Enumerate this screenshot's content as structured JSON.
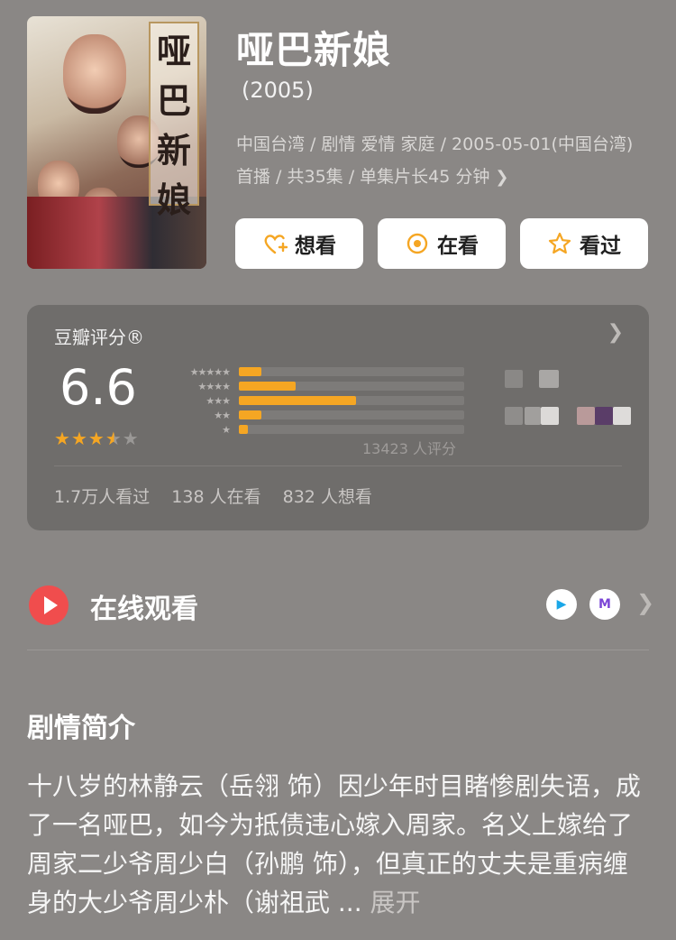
{
  "movie": {
    "title": "哑巴新娘",
    "year": "(2005)",
    "meta_line": "中国台湾 / 剧情 爱情 家庭 / 2005-05-01(中国台湾) 首播 / 共35集 / 单集片长45 分钟",
    "poster_title_chars": [
      "哑",
      "巴",
      "新",
      "娘"
    ]
  },
  "actions": {
    "want": "想看",
    "watching": "在看",
    "watched": "看过"
  },
  "rating": {
    "label": "豆瓣评分®",
    "score": "6.6",
    "stars": 3.5,
    "distribution": [
      {
        "stars": "★★★★★",
        "fraction": 0.1
      },
      {
        "stars": "★★★★",
        "fraction": 0.25
      },
      {
        "stars": "★★★",
        "fraction": 0.52
      },
      {
        "stars": "★★",
        "fraction": 0.1
      },
      {
        "stars": "★",
        "fraction": 0.04
      }
    ],
    "count": "13423 人评分",
    "stats": [
      "1.7万人看过",
      "138 人在看",
      "832 人想看"
    ]
  },
  "online": {
    "label": "在线观看",
    "platforms": [
      "▶",
      "M"
    ]
  },
  "synopsis": {
    "title": "剧情简介",
    "text": "十八岁的林静云（岳翎 饰）因少年时目睹惨剧失语，成了一名哑巴，如今为抵债违心嫁入周家。名义上嫁给了周家二少爷周少白（孙鹏 饰），但真正的丈夫是重病缠身的大少爷周少朴（谢祖武 ...",
    "expand": "展开"
  },
  "colors": {
    "accent": "#f5a623",
    "play_red": "#f04d4d",
    "page_bg": "#8a8785"
  }
}
